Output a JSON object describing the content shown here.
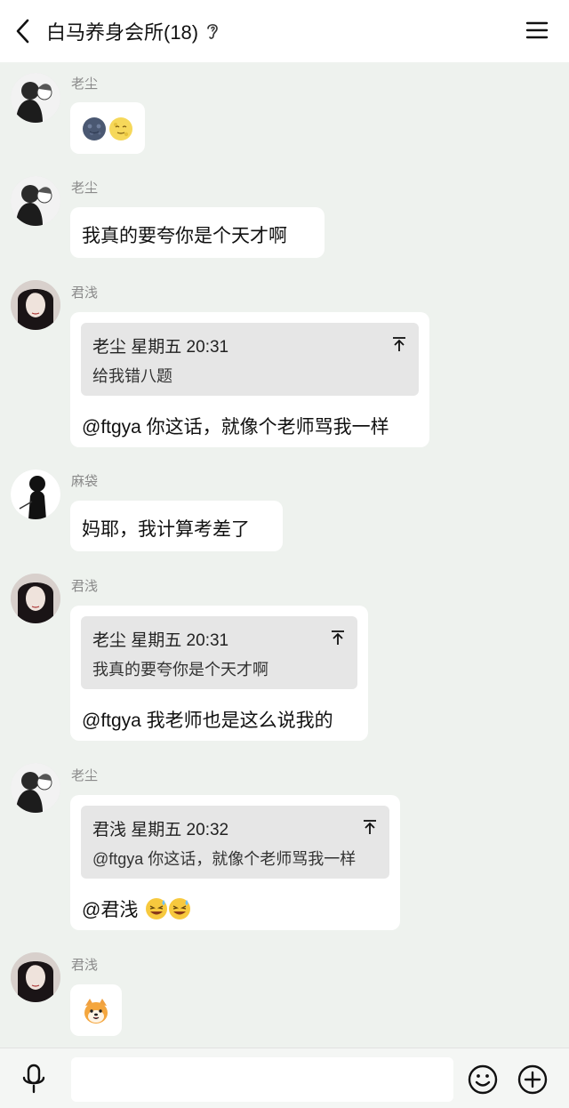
{
  "header": {
    "title": "白马养身会所(18)",
    "back_icon": "chevron-left-icon",
    "ear_icon": "ear-icon",
    "menu_icon": "hamburger-menu-icon"
  },
  "messages": [
    {
      "sender": "老尘",
      "type": "emoji",
      "content": [
        "new-moon-face-emoji",
        "full-moon-face-emoji"
      ]
    },
    {
      "sender": "老尘",
      "type": "text",
      "text": "我真的要夸你是个天才啊"
    },
    {
      "sender": "君浅",
      "type": "reply",
      "quote_header": "老尘 星期五 20:31",
      "quote_text": "给我错八题",
      "text": "@ftgya 你这话，就像个老师骂我一样"
    },
    {
      "sender": "麻袋",
      "type": "text",
      "text": "妈耶，我计算考差了"
    },
    {
      "sender": "君浅",
      "type": "reply",
      "quote_header": "老尘 星期五 20:31",
      "quote_text": "我真的要夸你是个天才啊",
      "text": "@ftgya 我老师也是这么说我的"
    },
    {
      "sender": "老尘",
      "type": "reply",
      "quote_header": "君浅 星期五 20:32",
      "quote_text": "@ftgya 你这话，就像个老师骂我一样",
      "text": "@君浅",
      "trailing_emoji": [
        "laughing-sweat-emoji",
        "laughing-sweat-emoji"
      ]
    },
    {
      "sender": "君浅",
      "type": "emoji",
      "content": [
        "shiba-dog-emoji"
      ]
    }
  ],
  "input_bar": {
    "mic_icon": "microphone-icon",
    "input_placeholder": "",
    "emoji_icon": "smiley-icon",
    "plus_icon": "plus-circle-icon"
  }
}
